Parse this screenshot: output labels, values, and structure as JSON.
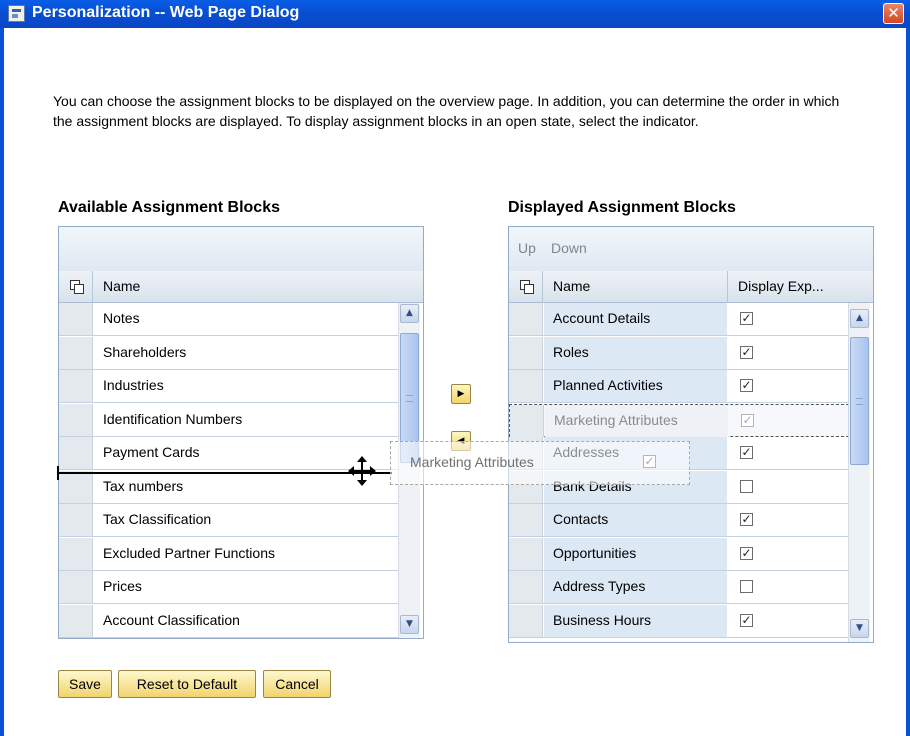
{
  "window": {
    "title": "Personalization -- Web Page Dialog",
    "close_glyph": "✕"
  },
  "intro_text": "You can choose the assignment blocks to be displayed on the overview page. In addition, you can determine the order in which the assignment blocks are displayed. To display assignment blocks in an open state, select the indicator.",
  "available": {
    "heading": "Available Assignment Blocks",
    "column_name": "Name",
    "items": [
      "Notes",
      "Shareholders",
      "Industries",
      "Identification Numbers",
      "Payment Cards",
      "Tax numbers",
      "Tax Classification",
      "Excluded Partner Functions",
      "Prices",
      "Account Classification"
    ]
  },
  "displayed": {
    "heading": "Displayed Assignment Blocks",
    "toolbar_up": "Up",
    "toolbar_down": "Down",
    "column_name": "Name",
    "column_display": "Display Exp...",
    "items": [
      {
        "name": "Account Details",
        "checked": true
      },
      {
        "name": "Roles",
        "checked": true
      },
      {
        "name": "Planned Activities",
        "checked": true
      },
      {
        "name": "Marketing Attributes",
        "checked": true
      },
      {
        "name": "Addresses",
        "checked": true
      },
      {
        "name": "Bank Details",
        "checked": false
      },
      {
        "name": "Contacts",
        "checked": true
      },
      {
        "name": "Opportunities",
        "checked": true
      },
      {
        "name": "Address Types",
        "checked": false
      },
      {
        "name": "Business Hours",
        "checked": true
      }
    ]
  },
  "drag": {
    "ghost_label": "Marketing Attributes"
  },
  "buttons": {
    "save": "Save",
    "reset": "Reset to Default",
    "cancel": "Cancel"
  },
  "icons": {
    "window": "web-page-dialog-icon",
    "close": "close-icon",
    "move_right": "move-right-arrow-icon",
    "move_left": "move-left-arrow-icon",
    "drag": "move-cursor-icon"
  }
}
